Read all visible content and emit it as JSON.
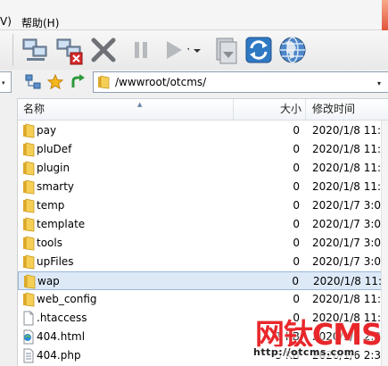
{
  "menubar": {
    "partial_item": "V)",
    "help_label": "帮助(H)"
  },
  "toolbar": {
    "buttons": [
      "connect-icon",
      "disconnect-icon",
      "stop-icon",
      "pause-icon",
      "play-icon",
      "queue-icon",
      "refresh-icon",
      "globe-icon"
    ]
  },
  "address": {
    "path": "/wwwroot/otcms/",
    "left_dropdown": "▾",
    "dropdown": "▾"
  },
  "list": {
    "columns": {
      "name": "名称",
      "size": "大小",
      "modified": "修改时间"
    },
    "rows": [
      {
        "name": "pay",
        "size": "0",
        "date": "2020/1/8 11:1",
        "icon": "folder-icon"
      },
      {
        "name": "pluDef",
        "size": "0",
        "date": "2020/1/8 11:1",
        "icon": "folder-icon"
      },
      {
        "name": "plugin",
        "size": "0",
        "date": "2020/1/8 11:1",
        "icon": "folder-icon"
      },
      {
        "name": "smarty",
        "size": "0",
        "date": "2020/1/8 11:1",
        "icon": "folder-icon"
      },
      {
        "name": "temp",
        "size": "0",
        "date": "2020/1/7 3:01",
        "icon": "folder-icon"
      },
      {
        "name": "template",
        "size": "0",
        "date": "2020/1/7 3:01",
        "icon": "folder-icon"
      },
      {
        "name": "tools",
        "size": "0",
        "date": "2020/1/7 3:02",
        "icon": "folder-icon"
      },
      {
        "name": "upFiles",
        "size": "0",
        "date": "2020/1/7 3:02",
        "icon": "folder-icon"
      },
      {
        "name": "wap",
        "size": "0",
        "date": "2020/1/8 11:1",
        "icon": "folder-icon",
        "selected": true
      },
      {
        "name": "web_config",
        "size": "0",
        "date": "2020/1/8 11:1",
        "icon": "folder-icon"
      },
      {
        "name": ".htaccess",
        "size": "0",
        "date": "2020/1/8 11:1",
        "icon": "file-icon"
      },
      {
        "name": "404.html",
        "size": "1 KB",
        "date": "2020/1/6 2:34",
        "icon": "html-file-icon"
      },
      {
        "name": "404.php",
        "size": "5 KB",
        "date": "2020/1/6 2:34",
        "icon": "php-file-icon"
      }
    ]
  },
  "watermark": {
    "title": "网钛CMS",
    "url": "http://otcms.com"
  },
  "colors": {
    "folder": "#f2c94c",
    "selection": "#dde9f7",
    "watermark_red": "#e8272b"
  }
}
